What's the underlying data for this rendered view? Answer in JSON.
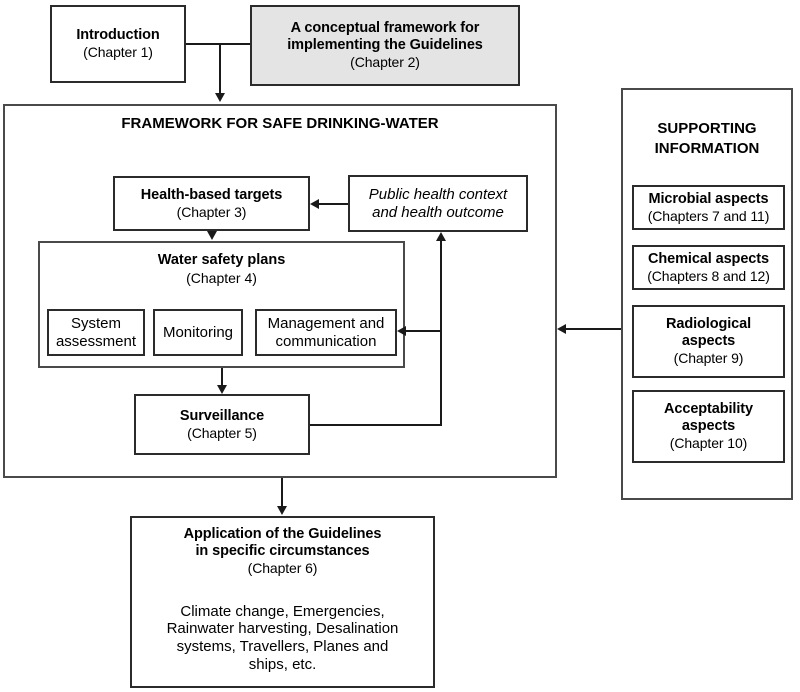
{
  "diagram": {
    "title": "Framework for safe drinking-water",
    "intro": {
      "title": "Introduction",
      "chapter": "(Chapter 1)"
    },
    "conceptual": {
      "title_line1": "A conceptual framework for",
      "title_line2": "implementing the Guidelines",
      "chapter": "(Chapter 2)",
      "fill_color": "#e4e4e4"
    },
    "framework": {
      "heading": "FRAMEWORK FOR SAFE DRINKING-WATER",
      "health_targets": {
        "title": "Health-based targets",
        "chapter": "(Chapter 3)"
      },
      "public_health": {
        "line1": "Public health context",
        "line2": "and health outcome"
      },
      "water_safety_plans": {
        "title": "Water safety plans",
        "chapter": "(Chapter 4)",
        "components": [
          {
            "line1": "System",
            "line2": "assessment"
          },
          {
            "line1": "Monitoring",
            "line2": ""
          },
          {
            "line1": "Management and",
            "line2": "communication"
          }
        ]
      },
      "surveillance": {
        "title": "Surveillance",
        "chapter": "(Chapter 5)"
      }
    },
    "supporting": {
      "heading_line1": "SUPPORTING",
      "heading_line2": "INFORMATION",
      "items": [
        {
          "title_line1": "Microbial aspects",
          "title_line2": "",
          "chapter": "(Chapters 7 and 11)"
        },
        {
          "title_line1": "Chemical aspects",
          "title_line2": "",
          "chapter": "(Chapters 8 and 12)"
        },
        {
          "title_line1": "Radiological",
          "title_line2": "aspects",
          "chapter": "(Chapter 9)"
        },
        {
          "title_line1": "Acceptability",
          "title_line2": "aspects",
          "chapter": "(Chapter 10)"
        }
      ]
    },
    "application": {
      "title_line1": "Application of the Guidelines",
      "title_line2": "in specific circumstances",
      "chapter": "(Chapter 6)",
      "body_line1": "Climate change, Emergencies,",
      "body_line2": "Rainwater harvesting, Desalination",
      "body_line3": "systems, Travellers, Planes and",
      "body_line4": "ships, etc."
    }
  }
}
